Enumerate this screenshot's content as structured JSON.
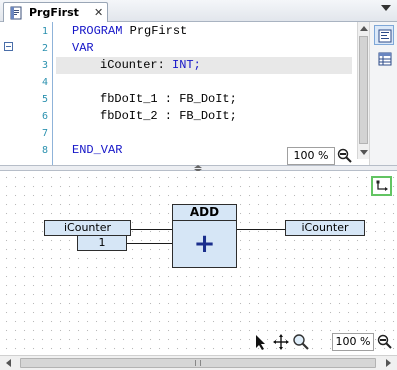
{
  "tab": {
    "title": "PrgFirst",
    "close_glyph": "✕"
  },
  "declaration": {
    "line_numbers": [
      "1",
      "2",
      "3",
      "4",
      "5",
      "6",
      "7",
      "8"
    ],
    "lines": {
      "l1_kw": "PROGRAM",
      "l1_name": " PrgFirst",
      "l2_kw": "VAR",
      "l3_name": "iCounter:",
      "l3_type": " INT;",
      "l5": "fbDoIt_1 : FB_DoIt;",
      "l6": "fbDoIt_2 : FB_DoIt;",
      "l8_kw": "END_VAR"
    },
    "zoom": "100 %"
  },
  "fbd": {
    "input_var": "iCounter",
    "input_const": "1",
    "block_name": "ADD",
    "block_symbol": "+",
    "output_var": "iCounter",
    "zoom": "100 %"
  },
  "colors": {
    "keyword": "#1616c8",
    "line_number": "#2b91af",
    "box_fill": "#d6e6f6",
    "active_tool_border": "#62c462"
  },
  "icons": {
    "tab": "program-document-icon",
    "text_view": "textual-view-icon",
    "table_view": "tabular-view-icon",
    "zoom": "zoom-magnifier-icon",
    "pointer": "pointer-arrow-icon",
    "pan": "pan-cross-icon",
    "magnifier": "magnifier-icon",
    "corner": "connection-mode-icon"
  }
}
